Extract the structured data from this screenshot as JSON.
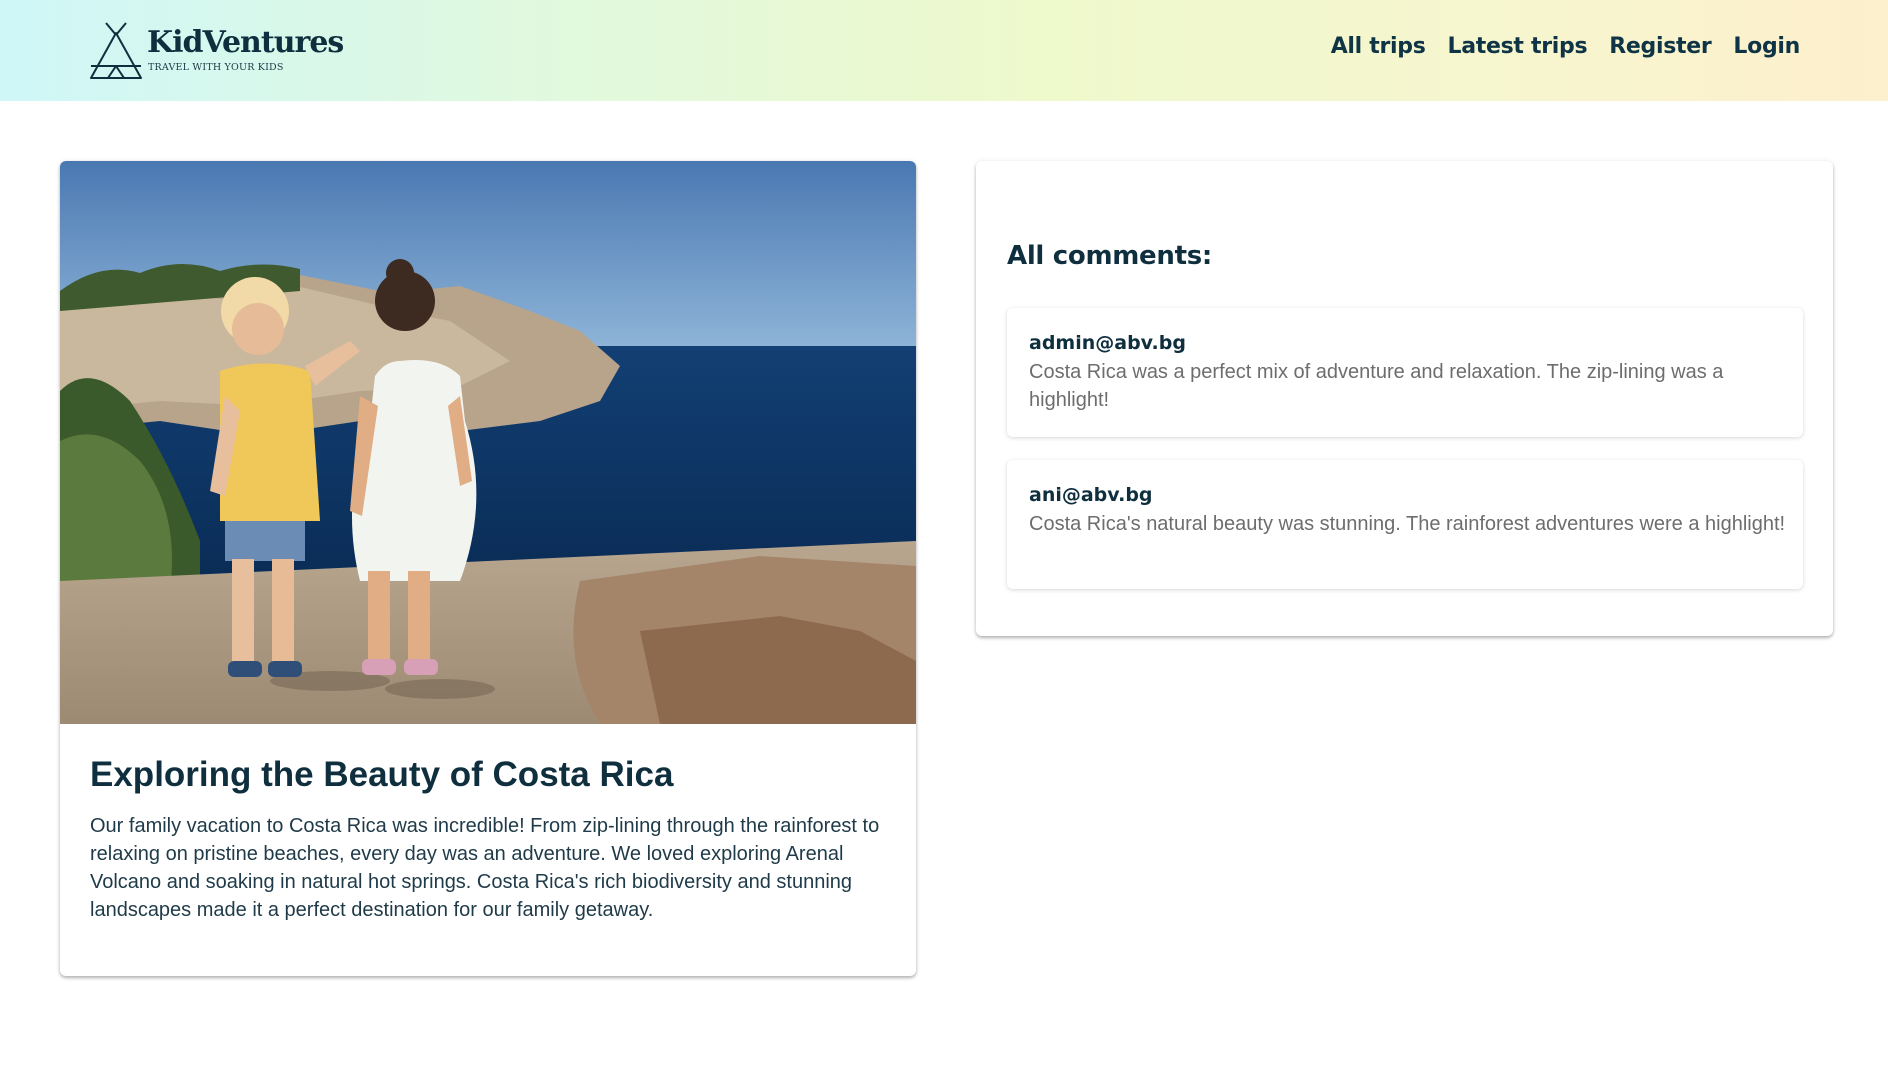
{
  "brand": {
    "name": "KidVentures",
    "tagline": "TRAVEL WITH YOUR KIDS",
    "logo_icon": "teepee-icon"
  },
  "nav": {
    "all_trips": "All trips",
    "latest_trips": "Latest trips",
    "register": "Register",
    "login": "Login"
  },
  "trip": {
    "image_alt": "Two children holding hands on a rocky cliff overlooking the sea",
    "title": "Exploring the Beauty of Costa Rica",
    "description": "Our family vacation to Costa Rica was incredible! From zip-lining through the rainforest to relaxing on pristine beaches, every day was an adventure. We loved exploring Arenal Volcano and soaking in natural hot springs. Costa Rica's rich biodiversity and stunning landscapes made it a perfect destination for our family getaway."
  },
  "comments": {
    "heading": "All comments:",
    "items": [
      {
        "author": "admin@abv.bg",
        "text": "Costa Rica was a perfect mix of adventure and relaxation. The zip-lining was a highlight!"
      },
      {
        "author": "ani@abv.bg",
        "text": "Costa Rica's natural beauty was stunning. The rainforest adventures were a highlight!"
      }
    ]
  },
  "colors": {
    "header_gradient_start": "#cff7f8",
    "header_gradient_end": "#fdf0cc",
    "primary_text": "#0f2f3f",
    "muted_text": "#6d6d6d"
  }
}
